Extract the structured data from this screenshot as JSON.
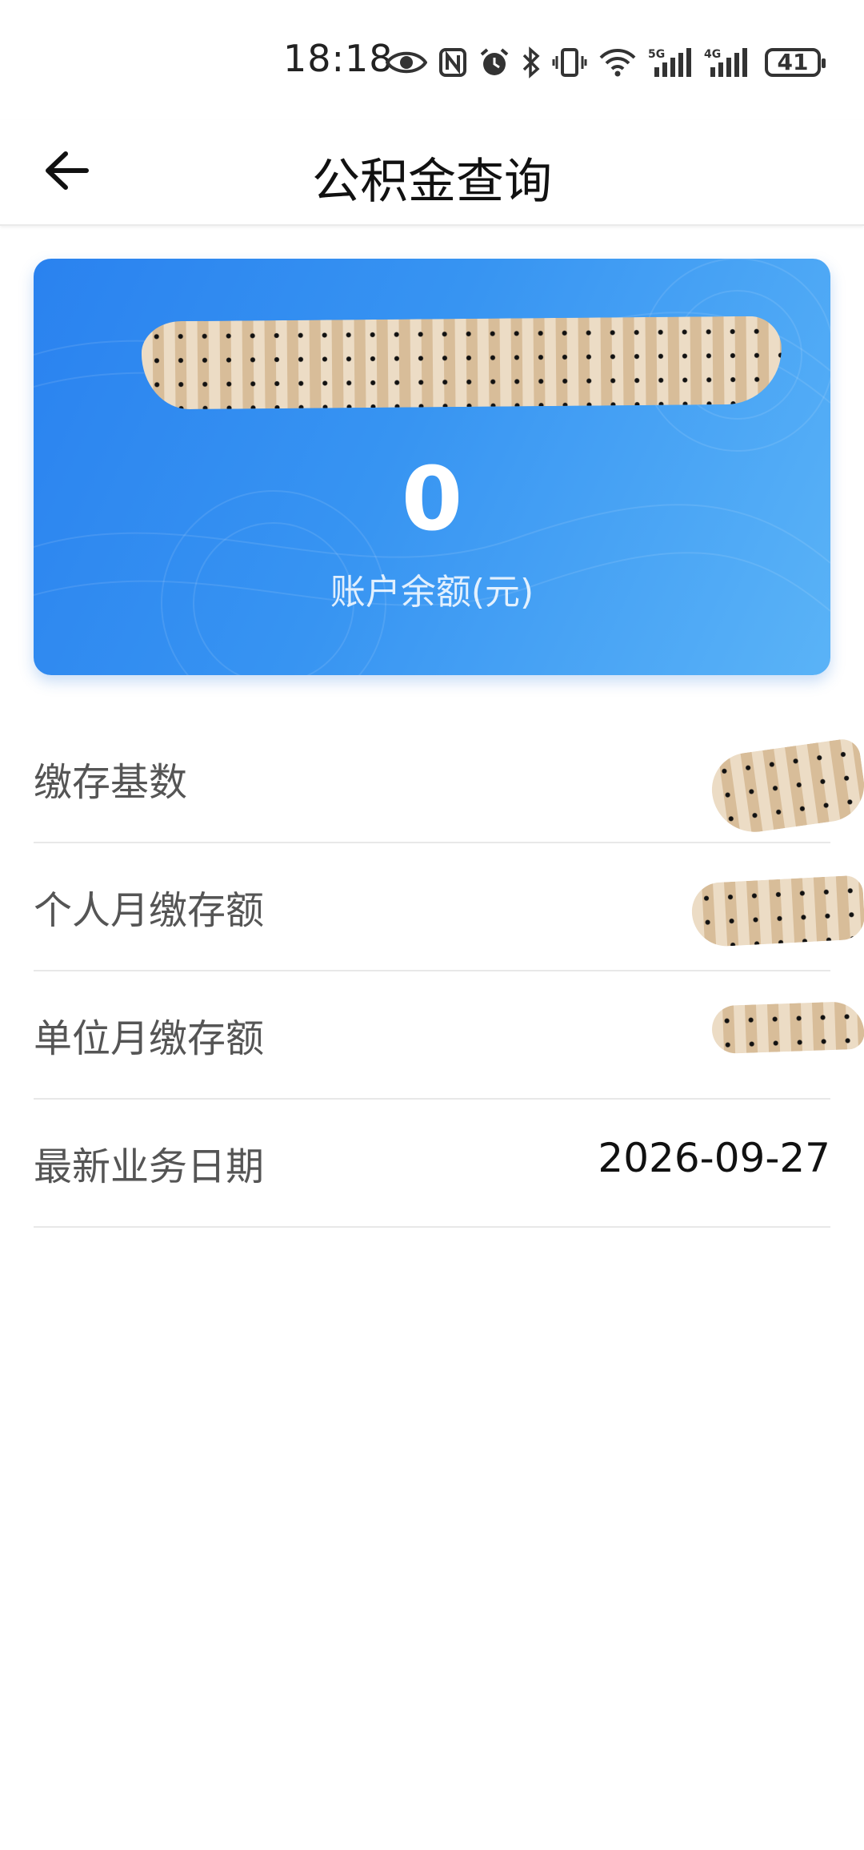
{
  "status_bar": {
    "time": "18:18",
    "icons": [
      "eye-icon",
      "nfc-icon",
      "alarm-icon",
      "bluetooth-icon",
      "vibrate-icon",
      "wifi-icon",
      "signal-5g-icon",
      "signal-4g-icon"
    ],
    "network_1": "5G",
    "network_2": "4G",
    "battery_level": "41"
  },
  "app_bar": {
    "title": "公积金查询",
    "back_icon": "arrow-left-icon"
  },
  "balance_card": {
    "balance": "0",
    "label": "账户余额(元)",
    "gradient_start": "#2a82ef",
    "gradient_end": "#5ab3f7"
  },
  "info_rows": [
    {
      "label": "缴存基数",
      "value": ""
    },
    {
      "label": "个人月缴存额",
      "value": ""
    },
    {
      "label": "单位月缴存额",
      "value": ""
    },
    {
      "label": "最新业务日期",
      "value": "2026-09-27"
    }
  ]
}
